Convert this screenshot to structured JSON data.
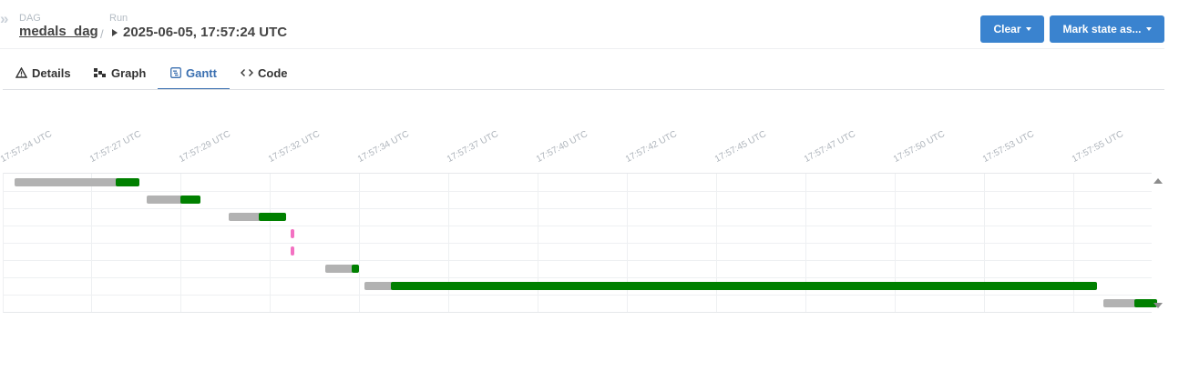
{
  "breadcrumb": {
    "dag_label": "DAG",
    "dag_value": "medals_dag",
    "run_label": "Run",
    "run_value": "2025-06-05, 17:57:24 UTC"
  },
  "actions": {
    "clear_label": "Clear",
    "mark_state_label": "Mark state as..."
  },
  "tabs": [
    {
      "label": "Details",
      "icon": "warning-icon"
    },
    {
      "label": "Graph",
      "icon": "graph-icon"
    },
    {
      "label": "Gantt",
      "icon": "gantt-icon",
      "active": true
    },
    {
      "label": "Code",
      "icon": "code-icon"
    }
  ],
  "gantt": {
    "ticks": [
      "17:57:24 UTC",
      "17:57:27 UTC",
      "17:57:29 UTC",
      "17:57:32 UTC",
      "17:57:34 UTC",
      "17:57:37 UTC",
      "17:57:40 UTC",
      "17:57:42 UTC",
      "17:57:45 UTC",
      "17:57:47 UTC",
      "17:57:50 UTC",
      "17:57:53 UTC",
      "17:57:55 UTC"
    ],
    "colors": {
      "queued": "#b2b2b2",
      "success": "#008000",
      "pending": "#f371c2"
    },
    "time_range_s": [
      0,
      31.6
    ],
    "tasks": [
      {
        "queued_start_s": 0.3,
        "start_s": 3.2,
        "end_s": 3.8,
        "state": "success"
      },
      {
        "queued_start_s": 4.0,
        "start_s": 5.0,
        "end_s": 5.5,
        "state": "success"
      },
      {
        "queued_start_s": 6.3,
        "start_s": 7.2,
        "end_s": 7.9,
        "state": "success"
      },
      {
        "queued_start_s": 8.0,
        "start_s": 8.0,
        "end_s": 8.1,
        "state": "pending"
      },
      {
        "queued_start_s": 8.0,
        "start_s": 8.0,
        "end_s": 8.1,
        "state": "pending"
      },
      {
        "queued_start_s": 9.0,
        "start_s": 9.8,
        "end_s": 9.95,
        "state": "success"
      },
      {
        "queued_start_s": 10.1,
        "start_s": 10.9,
        "end_s": 30.6,
        "state": "success"
      },
      {
        "queued_start_s": 30.8,
        "start_s": 31.7,
        "end_s": 32.3,
        "state": "success"
      }
    ]
  }
}
